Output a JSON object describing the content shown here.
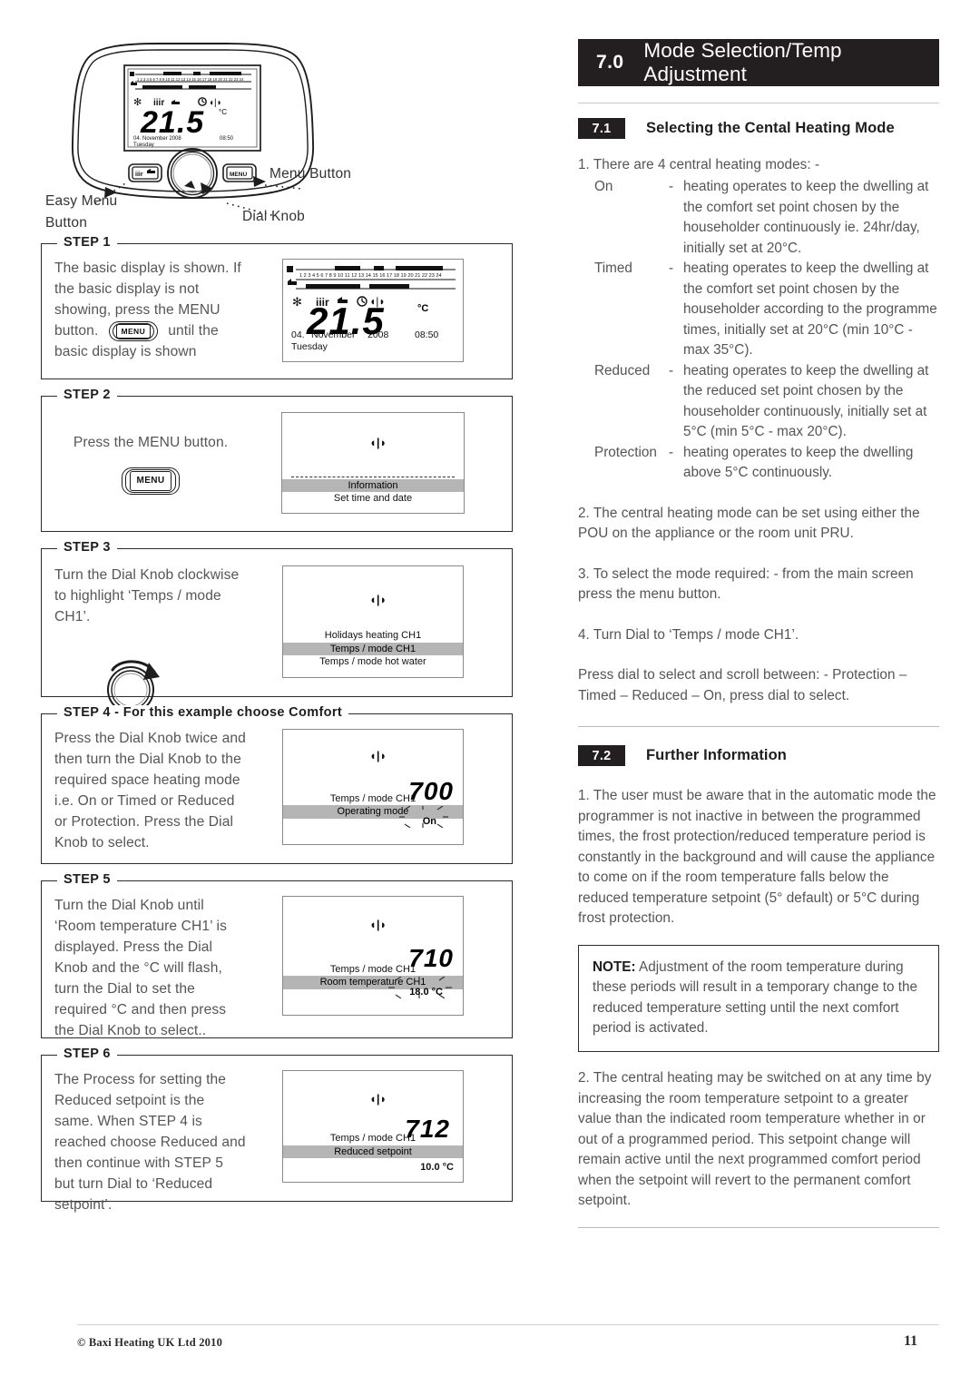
{
  "document": {
    "footer_copyright": "© Baxi Heating UK Ltd 2010",
    "page_number": "11"
  },
  "diagram": {
    "callouts": {
      "menu_button": "Menu Button",
      "dial_knob": "Dial Knob",
      "easy_menu_line1": "Easy Menu",
      "easy_menu_line2": "Button"
    },
    "device_display": {
      "temperature": "21.5",
      "unit": "°C",
      "day_num": "04.",
      "month": "November",
      "year": "2008",
      "time": "08:50",
      "weekday": "Tuesday"
    }
  },
  "steps": [
    {
      "legend": "STEP 1",
      "text": "The basic display is shown. If the basic display is not showing, press the MENU button.",
      "text_after": "until the basic display is shown",
      "button_label": "MENU",
      "display": {
        "kind": "basic",
        "temperature": "21.5",
        "unit": "°C",
        "day_num": "04.",
        "month": "November",
        "year": "2008",
        "time": "08:50",
        "weekday": "Tuesday"
      }
    },
    {
      "legend": "STEP 2",
      "text": "Press the MENU button.",
      "button_label": "MENU",
      "display": {
        "kind": "menu",
        "rows": [
          "Information",
          "Set time and date"
        ],
        "highlight_index": 0
      }
    },
    {
      "legend": "STEP 3",
      "text": "Turn the Dial Knob clockwise to highlight ‘Temps / mode CH1’.",
      "display": {
        "kind": "menu",
        "rows": [
          "Holidays heating  CH1",
          "Temps / mode CH1",
          "Temps / mode hot water"
        ],
        "highlight_index": 1
      }
    },
    {
      "legend": "STEP 4 - For this example choose Comfort",
      "text": "Press the Dial Knob twice and then turn the Dial Knob to the required space heating mode i.e. On or Timed or Reduced or Protection. Press the Dial Knob to select.",
      "display": {
        "kind": "value",
        "code": "700",
        "rows": [
          "Temps / mode CH1",
          "Operating mode"
        ],
        "highlight_index": 1,
        "value": "On"
      }
    },
    {
      "legend": "STEP 5",
      "text": "Turn the Dial Knob until ‘Room temperature CH1’ is displayed. Press the Dial Knob and the °C will flash, turn the Dial to set the required °C and then press the Dial Knob to select..",
      "display": {
        "kind": "value",
        "code": "710",
        "rows": [
          "Temps / mode CH1",
          "Room temperature CH1"
        ],
        "highlight_index": 1,
        "value": "18.0 °C"
      }
    },
    {
      "legend": "STEP 6",
      "text": "The Process for setting the Reduced setpoint is the same. When STEP 4 is reached choose Reduced and then continue with STEP 5 but turn Dial to ‘Reduced setpoint’.",
      "display": {
        "kind": "value_plain",
        "code": "712",
        "rows": [
          "Temps / mode CH1",
          "Reduced setpoint"
        ],
        "highlight_index": 1,
        "value": "10.0 °C"
      }
    }
  ],
  "chapter": {
    "number": "7.0",
    "title": "Mode Selection/Temp Adjustment"
  },
  "section_71": {
    "number": "7.1",
    "title": "Selecting the Cental Heating Mode",
    "intro": "1. There are 4 central heating modes: -",
    "modes": [
      {
        "name": "On",
        "dash": "-",
        "desc": "heating operates to keep the dwelling at the comfort set point chosen by the householder continuously ie. 24hr/day, initially set at 20°C."
      },
      {
        "name": "Timed",
        "dash": "-",
        "desc": "heating operates to keep the dwelling at the comfort set point chosen by the householder according to the programme times, initially set at 20°C (min 10°C - max 35°C)."
      },
      {
        "name": "Reduced",
        "dash": "-",
        "desc": "heating operates to keep the dwelling at the reduced set point chosen by the householder continuously, initially set at 5°C (min 5°C - max 20°C)."
      },
      {
        "name": "Protection",
        "dash": "-",
        "desc": "heating operates to keep the dwelling above 5°C continuously."
      }
    ],
    "p2": "2. The central heating mode can be set using either the POU on the appliance or the room unit PRU.",
    "p3": "3. To select the mode required: - from the main screen press the menu button.",
    "p4": "4. Turn Dial to ‘Temps / mode CH1’.",
    "p5": "Press dial to select and scroll between: - Protection – Timed – Reduced – On, press dial to select."
  },
  "section_72": {
    "number": "7.2",
    "title": "Further Information",
    "p1": "1. The user must be aware that in the automatic mode the programmer is not inactive in between the programmed times, the frost protection/reduced temperature period is constantly in the background and will cause the appliance to come on if the room temperature falls below the reduced temperature setpoint (5° default) or 5°C during frost protection.",
    "note_lead": "NOTE:",
    "note_body": " Adjustment of the room temperature during these periods will result in a temporary change to the reduced temperature setting until the next comfort period is activated.",
    "p2": "2. The central heating may be switched on at any time by increasing the room temperature setpoint to a greater value than the indicated room temperature  whether in or out of a programmed period. This setpoint change will remain active until the next programmed comfort period when the setpoint will revert to the permanent comfort setpoint."
  }
}
